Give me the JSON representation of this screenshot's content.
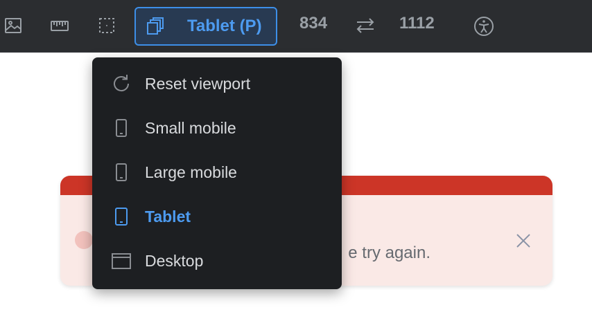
{
  "toolbar": {
    "icons": [
      "image-icon",
      "ruler-icon",
      "outline-frame-icon",
      "viewport-icon",
      "swap-icon",
      "accessibility-icon"
    ],
    "viewport_button_label": "Tablet (P)",
    "width_value": "834",
    "height_value": "1112"
  },
  "menu": {
    "items": [
      {
        "label": "Reset viewport",
        "icon": "reset-icon"
      },
      {
        "label": "Small mobile",
        "icon": "mobile-icon"
      },
      {
        "label": "Large mobile",
        "icon": "mobile-icon"
      },
      {
        "label": "Tablet",
        "icon": "tablet-icon",
        "active": true
      },
      {
        "label": "Desktop",
        "icon": "desktop-icon"
      }
    ]
  },
  "alert": {
    "message_visible_fragment": "e try again."
  },
  "colors": {
    "toolbar_bg": "#2b2d30",
    "accent": "#4d9bf0",
    "menu_bg": "#1d1f22",
    "alert_bar": "#cc3527",
    "alert_bg": "#fae9e6"
  }
}
